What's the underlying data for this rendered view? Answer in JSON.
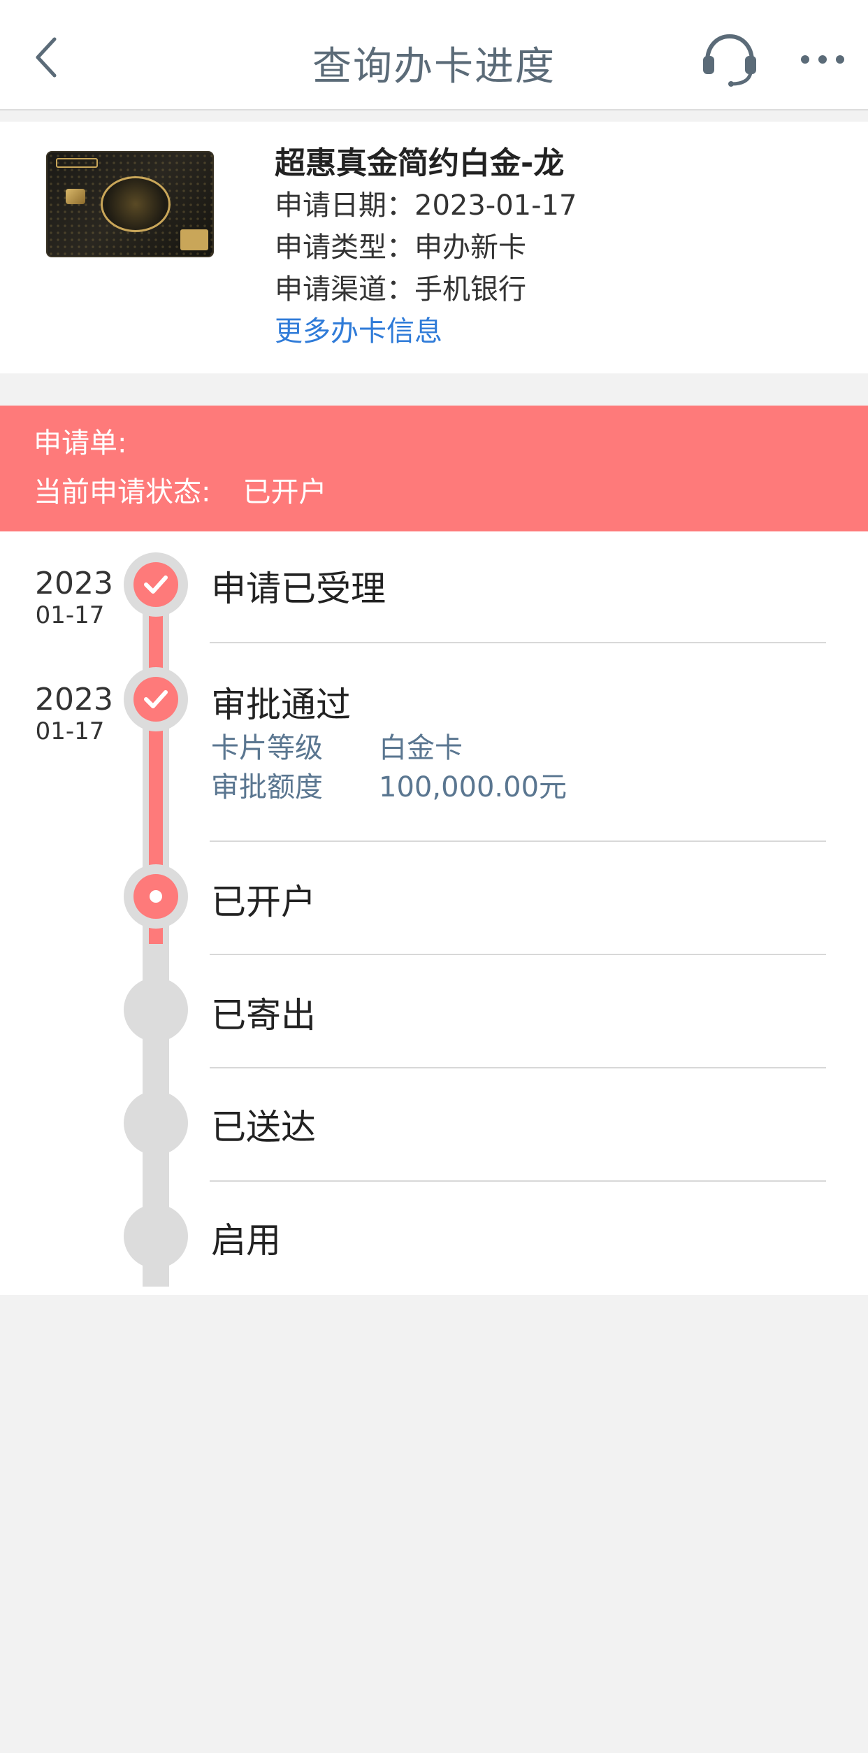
{
  "header": {
    "title": "查询办卡进度",
    "back_icon": "chevron-left-icon",
    "service_icon": "headset-icon",
    "more_icon": "more-dots-icon",
    "icon_color": "#5b6b78"
  },
  "card": {
    "name": "超惠真金简约白金-龙",
    "apply_date": "申请日期：2023-01-17",
    "apply_type": "申请类型：申办新卡",
    "apply_channel": "申请渠道：手机银行",
    "more_link": "更多办卡信息"
  },
  "status": {
    "application_label": "申请单:",
    "state_label": "当前申请状态:",
    "state_value": "已开户",
    "color": "#fe7a7a"
  },
  "timeline": {
    "steps": [
      {
        "title": "申请已受理",
        "year": "2023",
        "date": "01-17",
        "state": "done"
      },
      {
        "title": "审批通过",
        "year": "2023",
        "date": "01-17",
        "state": "done",
        "details": [
          {
            "key": "卡片等级",
            "value": "白金卡"
          },
          {
            "key": "审批额度",
            "value": "100,000.00元"
          }
        ]
      },
      {
        "title": "已开户",
        "state": "current"
      },
      {
        "title": "已寄出",
        "state": "pending"
      },
      {
        "title": "已送达",
        "state": "pending"
      },
      {
        "title": "启用",
        "state": "pending"
      }
    ]
  }
}
